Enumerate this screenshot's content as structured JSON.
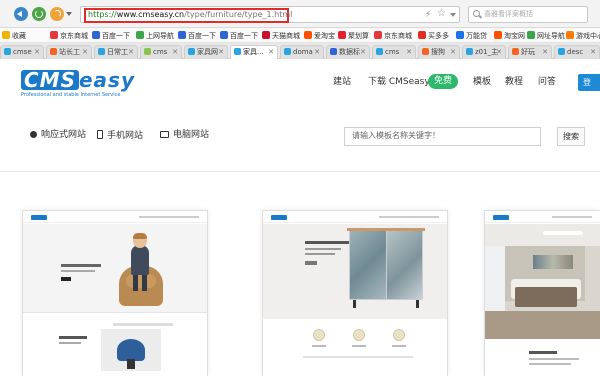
{
  "browser": {
    "url": {
      "scheme": "https://",
      "domain": "www.cmseasy.cn",
      "path": "/type/furniture/type_1.html"
    },
    "search_placeholder": "喜雅看评案概括"
  },
  "bookmarks": [
    {
      "label": "收藏",
      "color": "#f0b400"
    },
    {
      "label": "京东商城",
      "color": "#e4393c"
    },
    {
      "label": "百度一下",
      "color": "#2f64d6"
    },
    {
      "label": "上网导航",
      "color": "#3aa54a"
    },
    {
      "label": "百度一下",
      "color": "#2f64d6"
    },
    {
      "label": "百度一下",
      "color": "#2f64d6"
    },
    {
      "label": "天猫商城",
      "color": "#c8102e"
    },
    {
      "label": "爱淘宝",
      "color": "#ff5000"
    },
    {
      "label": "聚划算",
      "color": "#e8202a"
    },
    {
      "label": "京东商城",
      "color": "#e4393c"
    },
    {
      "label": "买多多",
      "color": "#e02e24"
    },
    {
      "label": "万能贷",
      "color": "#1a73e8"
    },
    {
      "label": "淘宝网",
      "color": "#ff5000"
    },
    {
      "label": "网址导航",
      "color": "#3aa54a"
    },
    {
      "label": "游戏中心",
      "color": "#ff7b00"
    }
  ],
  "tabs": [
    {
      "label": "cmse",
      "color": "#2aa4e0"
    },
    {
      "label": "站长工",
      "color": "#f26522"
    },
    {
      "label": "日常工",
      "color": "#2aa4e0"
    },
    {
      "label": "cms",
      "color": "#8bc34a"
    },
    {
      "label": "家具网",
      "color": "#2aa4e0"
    },
    {
      "label": "家具...",
      "color": "#2aa4e0"
    },
    {
      "label": "doma",
      "color": "#2aa4e0"
    },
    {
      "label": "数据标",
      "color": "#2f64d6"
    },
    {
      "label": "cms",
      "color": "#2aa4e0"
    },
    {
      "label": "搜狗",
      "color": "#f26522"
    },
    {
      "label": "z01_主",
      "color": "#2aa4e0"
    },
    {
      "label": "好玩",
      "color": "#f26522"
    },
    {
      "label": "desc",
      "color": "#2aa4e0"
    }
  ],
  "site": {
    "logo_cms": "CMS",
    "logo_easy": "easy",
    "logo_tagline": "Professional and stable Internet Service",
    "nav": [
      "建站",
      "下载 CMSeasy",
      "模板",
      "教程",
      "问答"
    ],
    "free_badge": "免费",
    "login_label": "登"
  },
  "filters": {
    "responsive": "响应式网站",
    "mobile": "手机网站",
    "pc": "电脑网站",
    "search_placeholder": "请输入模板名称关键字！",
    "search_button": "搜索"
  }
}
